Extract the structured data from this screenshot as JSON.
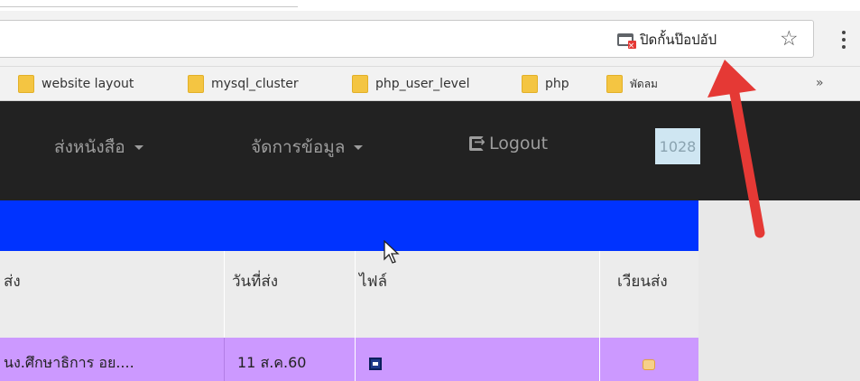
{
  "browser": {
    "popup_blocked_label": "ปิดกั้นป๊อปอัป",
    "bookmarks": [
      {
        "label": "website layout"
      },
      {
        "label": "mysql_cluster"
      },
      {
        "label": "php_user_level"
      },
      {
        "label": "php"
      },
      {
        "label": "พัดลม"
      }
    ],
    "bookmarks_more": "»"
  },
  "navbar": {
    "send_book": "ส่งหนังสือ",
    "manage_data": "จัดการข้อมูล",
    "logout": "Logout",
    "badge": "1028"
  },
  "table": {
    "headers": {
      "sender": "ส่ง",
      "date": "วันที่ส่ง",
      "file": "ไฟล์",
      "circulate": "เวียนส่ง"
    },
    "rows": [
      {
        "sender": "นง.ศึกษาธิการ อย....",
        "date": "11 ส.ค.60"
      }
    ]
  },
  "colors": {
    "navbar_bg": "#222222",
    "highlight_bar": "#0033ff",
    "row_bg": "#cc99ff",
    "annotation_arrow": "#e53935"
  }
}
